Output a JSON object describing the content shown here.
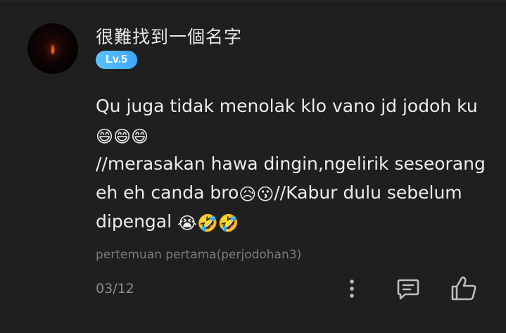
{
  "comment": {
    "username": "很難找到一個名字",
    "level": "Lv.5",
    "lines": [
      {
        "text": "Qu juga tidak menolak klo vano jd jodoh ku",
        "emojis": ""
      },
      {
        "text": "",
        "emojis": "😄😄😄"
      },
      {
        "text": "//merasakan hawa dingin,ngelirik seseorang",
        "emojis": ""
      },
      {
        "text": "eh eh canda bro",
        "emojis": "😥😗",
        "text_after": "//Kabur dulu sebelum"
      },
      {
        "text": "dipengal ",
        "emojis": "😭🤣🤣"
      }
    ],
    "source": "pertemuan pertama(perjodohan3)",
    "date": "03/12"
  },
  "actions": {
    "more_icon": "more-vertical-icon",
    "reply_icon": "comment-reply-icon",
    "like_icon": "thumbs-up-icon"
  },
  "colors": {
    "background": "#1f1f1f",
    "badge": "#3ea6ff",
    "text": "#ececec",
    "muted": "#7a7a7a",
    "icon": "#bdbdbd"
  }
}
